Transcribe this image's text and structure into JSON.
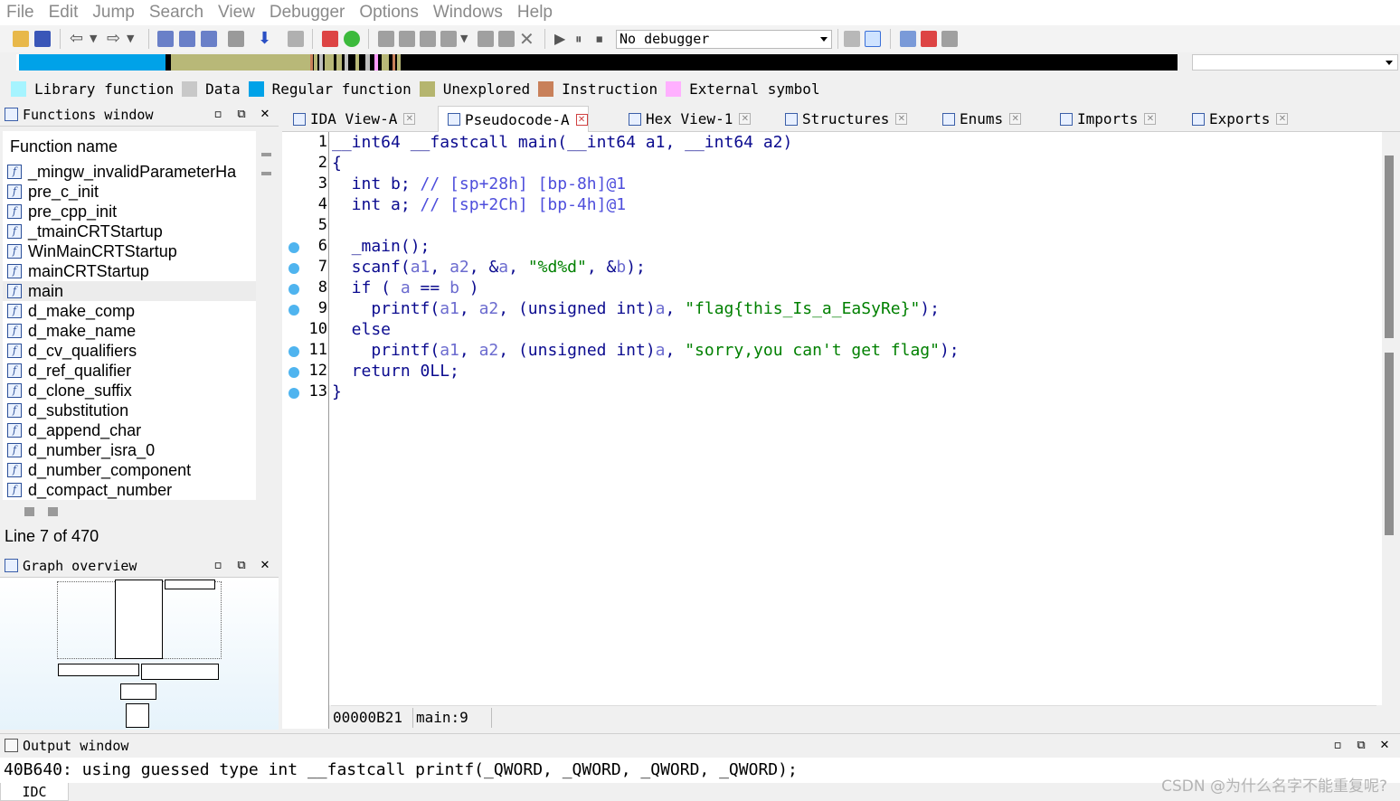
{
  "menu": [
    "File",
    "Edit",
    "Jump",
    "Search",
    "View",
    "Debugger",
    "Options",
    "Windows",
    "Help"
  ],
  "toolbar": {
    "debugger_select": "No debugger"
  },
  "nav_band": {
    "colors": {
      "library_function": "#80ffff",
      "data": "#c0c0c0",
      "regular_function": "#00a2e8",
      "unexplored": "#b8b878",
      "instruction": "#c8805a",
      "external_symbol": "#ff9cff",
      "navigator_background": "#000000"
    }
  },
  "legend": [
    {
      "label": "Library function",
      "color": "#a6f4ff"
    },
    {
      "label": "Data",
      "color": "#c8c8c8"
    },
    {
      "label": "Regular function",
      "color": "#00a2e8"
    },
    {
      "label": "Unexplored",
      "color": "#b5b56f"
    },
    {
      "label": "Instruction",
      "color": "#c8805a"
    },
    {
      "label": "External symbol",
      "color": "#ffb0ff"
    }
  ],
  "functions_window": {
    "title": "Functions window",
    "header": "Function name",
    "items": [
      "_mingw_invalidParameterHa",
      "pre_c_init",
      "pre_cpp_init",
      "_tmainCRTStartup",
      "WinMainCRTStartup",
      "mainCRTStartup",
      "main",
      "d_make_comp",
      "d_make_name",
      "d_cv_qualifiers",
      "d_ref_qualifier",
      "d_clone_suffix",
      "d_substitution",
      "d_append_char",
      "d_number_isra_0",
      "d_number_component",
      "d_compact_number"
    ],
    "selected": "main",
    "status": "Line 7 of 470"
  },
  "graph_overview": {
    "title": "Graph overview"
  },
  "tabs": [
    {
      "label": "IDA View-A",
      "active": false
    },
    {
      "label": "Pseudocode-A",
      "active": true
    },
    {
      "label": "Hex View-1",
      "active": false
    },
    {
      "label": "Structures",
      "active": false
    },
    {
      "label": "Enums",
      "active": false
    },
    {
      "label": "Imports",
      "active": false
    },
    {
      "label": "Exports",
      "active": false
    }
  ],
  "code": {
    "line_numbers": [
      "1",
      "2",
      "3",
      "4",
      "5",
      "6",
      "7",
      "8",
      "9",
      "10",
      "11",
      "12",
      "13"
    ],
    "breakpoint_lines": [
      6,
      7,
      8,
      9,
      11,
      12,
      13
    ],
    "lines": [
      [
        {
          "t": "__int64 __fastcall main(__int64 a1, __int64 a2)",
          "c": "kw"
        }
      ],
      [
        {
          "t": "{",
          "c": "blk-k"
        }
      ],
      [
        {
          "t": "  int b; ",
          "c": "kw"
        },
        {
          "t": "// [sp+28h] [bp-8h]@1",
          "c": "cmt"
        }
      ],
      [
        {
          "t": "  int a; ",
          "c": "kw"
        },
        {
          "t": "// [sp+2Ch] [bp-4h]@1",
          "c": "cmt"
        }
      ],
      [
        {
          "t": "",
          "c": "kw"
        }
      ],
      [
        {
          "t": "  _main();",
          "c": "kw"
        }
      ],
      [
        {
          "t": "  scanf(",
          "c": "kw"
        },
        {
          "t": "a1",
          "c": "var"
        },
        {
          "t": ", ",
          "c": "kw"
        },
        {
          "t": "a2",
          "c": "var"
        },
        {
          "t": ", &",
          "c": "kw"
        },
        {
          "t": "a",
          "c": "var"
        },
        {
          "t": ", ",
          "c": "kw"
        },
        {
          "t": "\"%d%d\"",
          "c": "str"
        },
        {
          "t": ", &",
          "c": "kw"
        },
        {
          "t": "b",
          "c": "var"
        },
        {
          "t": ");",
          "c": "kw"
        }
      ],
      [
        {
          "t": "  if ( ",
          "c": "kw"
        },
        {
          "t": "a",
          "c": "var"
        },
        {
          "t": " == ",
          "c": "kw"
        },
        {
          "t": "b",
          "c": "var"
        },
        {
          "t": " )",
          "c": "kw"
        }
      ],
      [
        {
          "t": "    printf(",
          "c": "kw"
        },
        {
          "t": "a1",
          "c": "var"
        },
        {
          "t": ", ",
          "c": "kw"
        },
        {
          "t": "a2",
          "c": "var"
        },
        {
          "t": ", (unsigned int)",
          "c": "kw"
        },
        {
          "t": "a",
          "c": "var"
        },
        {
          "t": ", ",
          "c": "kw"
        },
        {
          "t": "\"flag{this_Is_a_EaSyRe}\"",
          "c": "str"
        },
        {
          "t": ");",
          "c": "kw"
        }
      ],
      [
        {
          "t": "  else",
          "c": "kw"
        }
      ],
      [
        {
          "t": "    printf(",
          "c": "kw"
        },
        {
          "t": "a1",
          "c": "var"
        },
        {
          "t": ", ",
          "c": "kw"
        },
        {
          "t": "a2",
          "c": "var"
        },
        {
          "t": ", (unsigned int)",
          "c": "kw"
        },
        {
          "t": "a",
          "c": "var"
        },
        {
          "t": ", ",
          "c": "kw"
        },
        {
          "t": "\"sorry,you can't get flag\"",
          "c": "str"
        },
        {
          "t": ");",
          "c": "kw"
        }
      ],
      [
        {
          "t": "  return 0LL;",
          "c": "kw"
        }
      ],
      [
        {
          "t": "}",
          "c": "blk-k"
        }
      ]
    ],
    "status_address": "00000B21",
    "status_location": "main:9"
  },
  "output_window": {
    "title": "Output window",
    "text": "40B640: using guessed type int __fastcall printf(_QWORD, _QWORD, _QWORD, _QWORD);",
    "idc_tab": "IDC"
  },
  "watermark": "CSDN @为什么名字不能重复呢?"
}
